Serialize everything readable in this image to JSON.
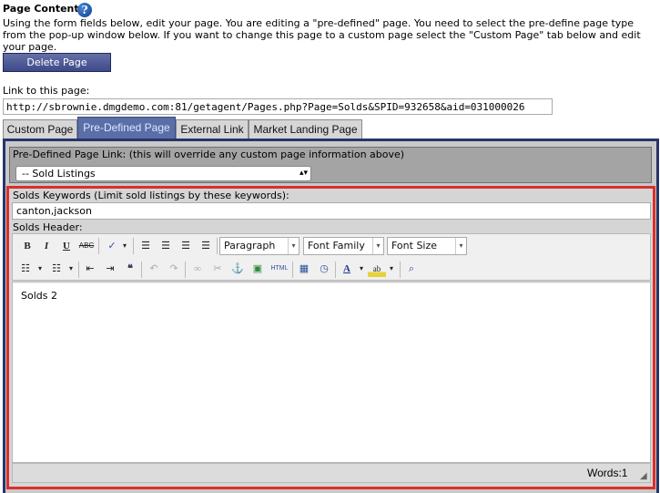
{
  "header": {
    "title": "Page Content",
    "help_icon_glyph": "?",
    "intro": "Using the form fields below, edit your page. You are editing a \"pre-defined\" page. You need to select the pre-define page type from the pop-up window below. If you want to change this page to a custom page select the \"Custom Page\" tab below and edit your page."
  },
  "actions": {
    "delete_label": "Delete Page"
  },
  "link": {
    "label": "Link to this page:",
    "value": "http://sbrownie.dmgdemo.com:81/getagent/Pages.php?Page=Solds&SPID=932658&aid=031000026"
  },
  "tabs": [
    {
      "label": "Custom Page",
      "active": false
    },
    {
      "label": "Pre-Defined Page",
      "active": true
    },
    {
      "label": "External Link",
      "active": false
    },
    {
      "label": "Market Landing Page",
      "active": false
    }
  ],
  "predefined": {
    "label": "Pre-Defined Page Link: (this will override any custom page information above)",
    "selected": "-- Sold Listings"
  },
  "keywords": {
    "label": "Solds Keywords (Limit sold listings by these keywords):",
    "value": "canton,jackson"
  },
  "editor": {
    "header_label": "Solds Header:",
    "format_select": "Paragraph",
    "font_family_select": "Font Family",
    "font_size_select": "Font Size",
    "content": "Solds 2",
    "word_count": "Words:1",
    "toolbar_text": {
      "bold": "B",
      "italic": "I",
      "underline": "U",
      "strike": "ABC",
      "html": "HTML"
    }
  },
  "colors": {
    "active_tab": "#5a6fa8",
    "panel_border": "#28356a",
    "highlight_border": "#d8302a",
    "button": "#4a5790"
  }
}
